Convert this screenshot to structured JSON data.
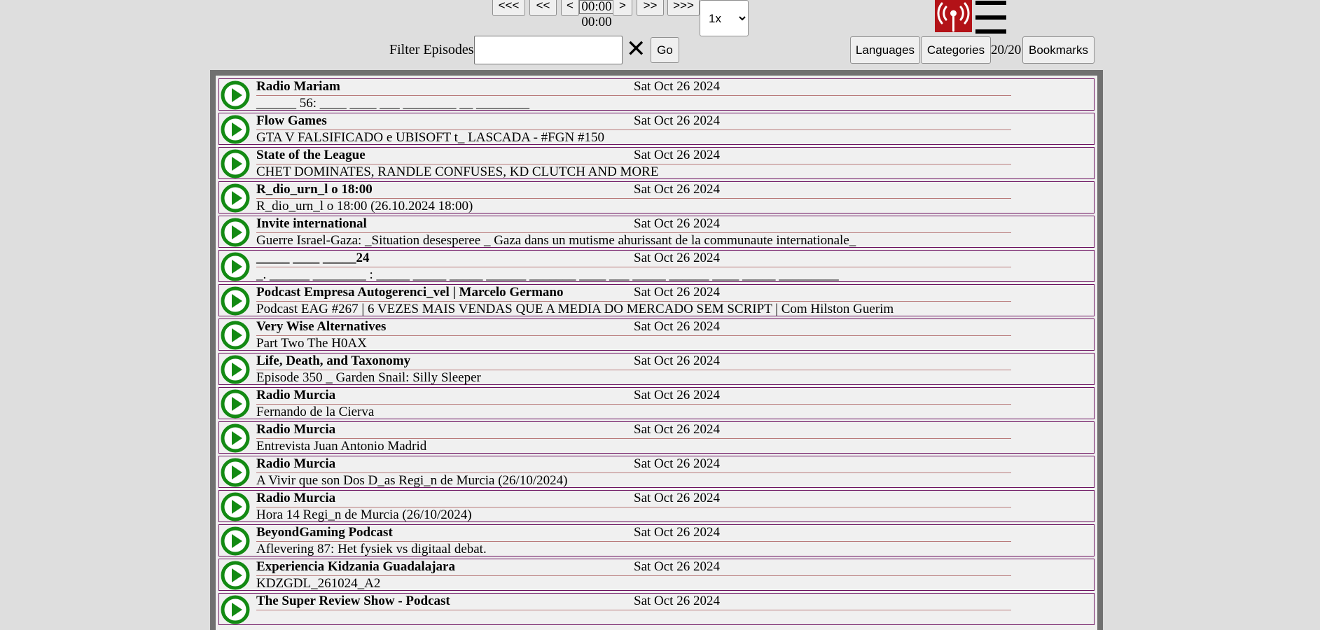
{
  "player": {
    "buttons": [
      "<<<",
      "<<",
      "<",
      ">",
      ">>",
      ">>>"
    ],
    "current_time": "00:00",
    "total_time": "00:00",
    "speed": "1x",
    "speed_options": [
      "1x"
    ]
  },
  "filter": {
    "label": "Filter Episodes",
    "value": "",
    "clear": "✕",
    "go": "Go"
  },
  "nav": {
    "languages": "Languages",
    "categories": "Categories",
    "count": "20/20",
    "bookmarks": "Bookmarks"
  },
  "colors": {
    "play": "#138a13",
    "row_border": "#6a0f5e",
    "logo_bg": "#b31217"
  },
  "icons": {
    "play": "play-circle-icon",
    "logo": "radio-antenna-icon",
    "menu": "hamburger-menu-icon",
    "clear": "close-icon"
  },
  "episodes": [
    {
      "title": "Radio Mariam",
      "date": "Sat Oct 26 2024",
      "desc": "______ 56: ____ ____ ___ ________ __ ________"
    },
    {
      "title": "Flow Games",
      "date": "Sat Oct 26 2024",
      "desc": "GTA V FALSIFICADO e UBISOFT t_ LASCADA - #FGN #150"
    },
    {
      "title": "State of the League",
      "date": "Sat Oct 26 2024",
      "desc": "CHET DOMINATES, RANDLE CONFUSES, KD CLUTCH AND MORE"
    },
    {
      "title": "R_dio_urn_l o 18:00",
      "date": "Sat Oct 26 2024",
      "desc": "R_dio_urn_l o 18:00 (26.10.2024 18:00)"
    },
    {
      "title": "Invite international",
      "date": "Sat Oct 26 2024",
      "desc": "Guerre Israel-Gaza: _Situation desesperee _ Gaza dans un mutisme ahurissant de la communaute internationale_"
    },
    {
      "title": "_____ ____ _____24",
      "date": "Sat Oct 26 2024",
      "desc": "_. ______ ________ : _____ _____ _____ ______ _______ ____ ___ _____ ______ ____ _____ _________"
    },
    {
      "title": "Podcast Empresa Autogerenci_vel | Marcelo Germano",
      "date": "Sat Oct 26 2024",
      "desc": "Podcast EAG #267 | 6 VEZES MAIS VENDAS QUE A MEDIA DO MERCADO SEM SCRIPT | Com Hilston Guerim"
    },
    {
      "title": "Very Wise Alternatives",
      "date": "Sat Oct 26 2024",
      "desc": "Part Two The H0AX"
    },
    {
      "title": "Life, Death, and Taxonomy",
      "date": "Sat Oct 26 2024",
      "desc": "Episode 350 _ Garden Snail: Silly Sleeper"
    },
    {
      "title": "Radio Murcia",
      "date": "Sat Oct 26 2024",
      "desc": "Fernando de la Cierva"
    },
    {
      "title": "Radio Murcia",
      "date": "Sat Oct 26 2024",
      "desc": "Entrevista Juan Antonio Madrid"
    },
    {
      "title": "Radio Murcia",
      "date": "Sat Oct 26 2024",
      "desc": "A Vivir que son Dos D_as Regi_n de Murcia (26/10/2024)"
    },
    {
      "title": "Radio Murcia",
      "date": "Sat Oct 26 2024",
      "desc": "Hora 14 Regi_n de Murcia (26/10/2024)"
    },
    {
      "title": "BeyondGaming Podcast",
      "date": "Sat Oct 26 2024",
      "desc": "Aflevering 87: Het fysiek vs digitaal debat."
    },
    {
      "title": "Experiencia Kidzania Guadalajara",
      "date": "Sat Oct 26 2024",
      "desc": "KDZGDL_261024_A2"
    },
    {
      "title": "The Super Review Show - Podcast",
      "date": "Sat Oct 26 2024",
      "desc": ""
    }
  ]
}
